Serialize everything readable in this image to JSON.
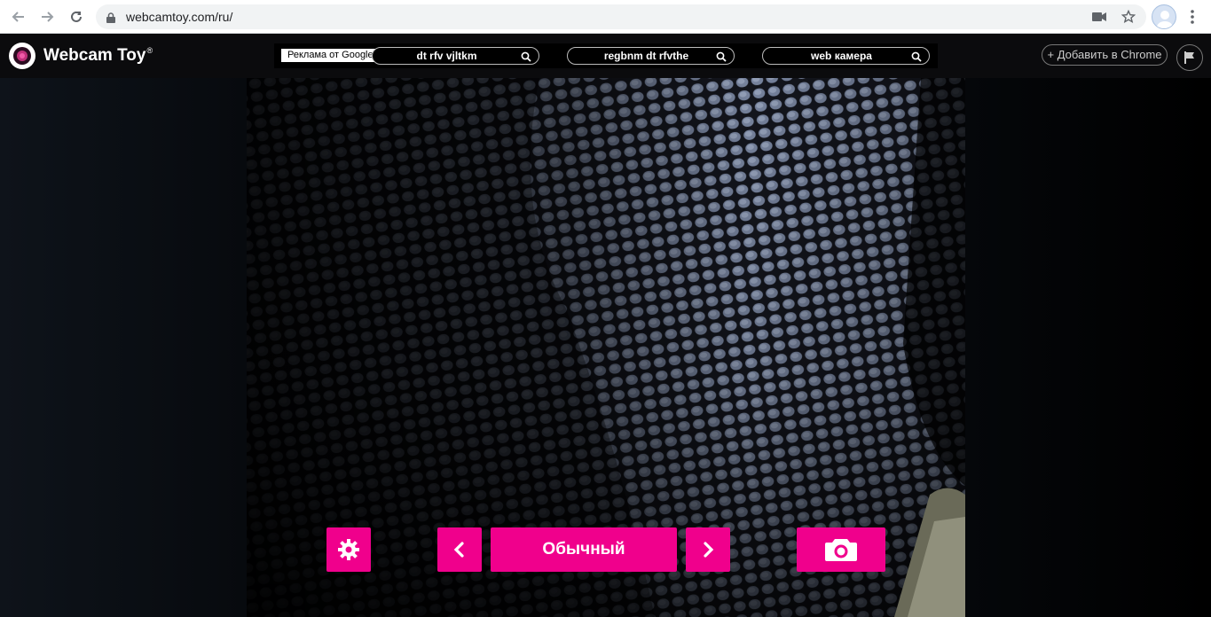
{
  "browser": {
    "url": "webcamtoy.com/ru/",
    "icons": [
      "back-arrow-icon",
      "forward-arrow-icon",
      "reload-icon",
      "lock-icon",
      "camera-permission-icon",
      "star-icon",
      "avatar",
      "menu-dots-icon"
    ]
  },
  "site": {
    "logo_text": "Webcam Toy",
    "logo_reg": "®",
    "ad": {
      "label": "Реклама от Google",
      "links": [
        "dt rfv vjltkm",
        "regbnm dt rfvthe",
        "web камера"
      ]
    },
    "add_to_chrome": "+ Добавить в Chrome"
  },
  "controls": {
    "effect_name": "Обычный",
    "icons": [
      "gear-icon",
      "chevron-left-icon",
      "chevron-right-icon",
      "camera-icon"
    ]
  },
  "colors": {
    "accent": "#f0008c",
    "header_bg": "#0b0b0d"
  }
}
